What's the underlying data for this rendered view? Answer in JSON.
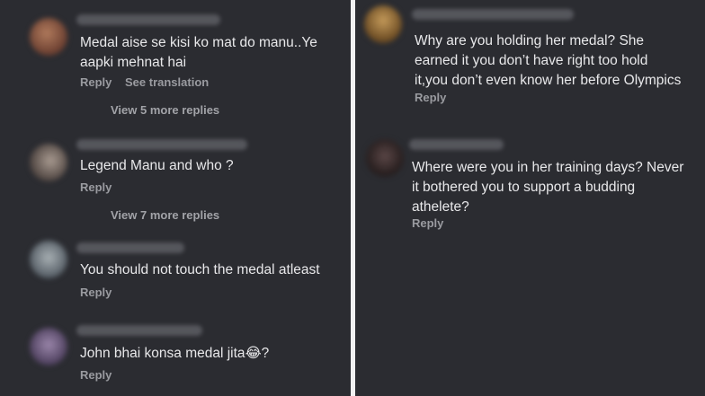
{
  "left": {
    "comments": [
      {
        "text": "Medal aise se kisi ko mat do manu..Ye\naapki mehnat hai",
        "reply": "Reply",
        "see_translation": "See translation",
        "more_replies": "View 5 more replies",
        "avatar_color": "#8a5a44"
      },
      {
        "text": "Legend Manu and who ?",
        "reply": "Reply",
        "more_replies": "View 7 more replies",
        "avatar_color": "#6d6058"
      },
      {
        "text": "You should not touch the medal atleast",
        "reply": "Reply",
        "avatar_color": "#727a80"
      },
      {
        "text": "John bhai konsa medal jita😂?",
        "reply": "Reply",
        "avatar_color": "#6b5a7a"
      }
    ]
  },
  "right": {
    "comments": [
      {
        "text": "Why are you holding her medal? She\nearned it you don’t have right too hold\nit,you don’t even know her before Olympics",
        "reply": "Reply",
        "avatar_color": "#8a6a3a"
      },
      {
        "text": "Where were you in her training days? Never\nit bothered you to support a budding\nathelete?",
        "reply": "Reply",
        "avatar_color": "#3a3030"
      }
    ]
  },
  "colors": {
    "background": "#2b2c31",
    "text": "#e8e8ea",
    "muted": "#9a9ba0"
  }
}
